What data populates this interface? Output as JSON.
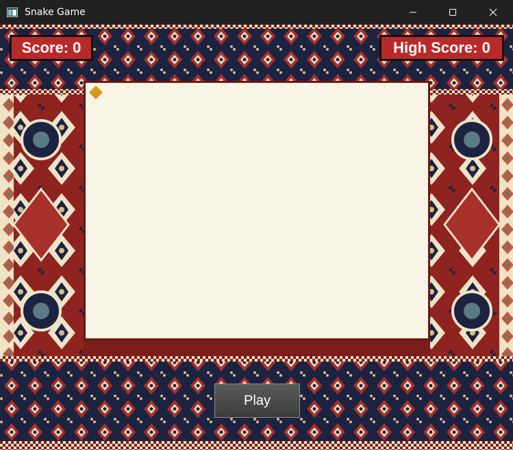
{
  "window": {
    "title": "Snake Game",
    "icon": "app-window-icon",
    "controls": [
      "minimize-icon",
      "maximize-icon",
      "close-icon"
    ]
  },
  "hud": {
    "score_label": "Score: 0",
    "high_score_label": "High Score: 0"
  },
  "game": {
    "food": "diamond-food",
    "food_color": "#d49a1c",
    "field_color": "#f8f4e6",
    "border_color": "#6b1712"
  },
  "controls": {
    "play_label": "Play"
  },
  "colors": {
    "score_bg": "#b82a2a",
    "carpet_red": "#7b1d1a",
    "carpet_navy": "#1b2340",
    "carpet_cream": "#efe3c8"
  }
}
